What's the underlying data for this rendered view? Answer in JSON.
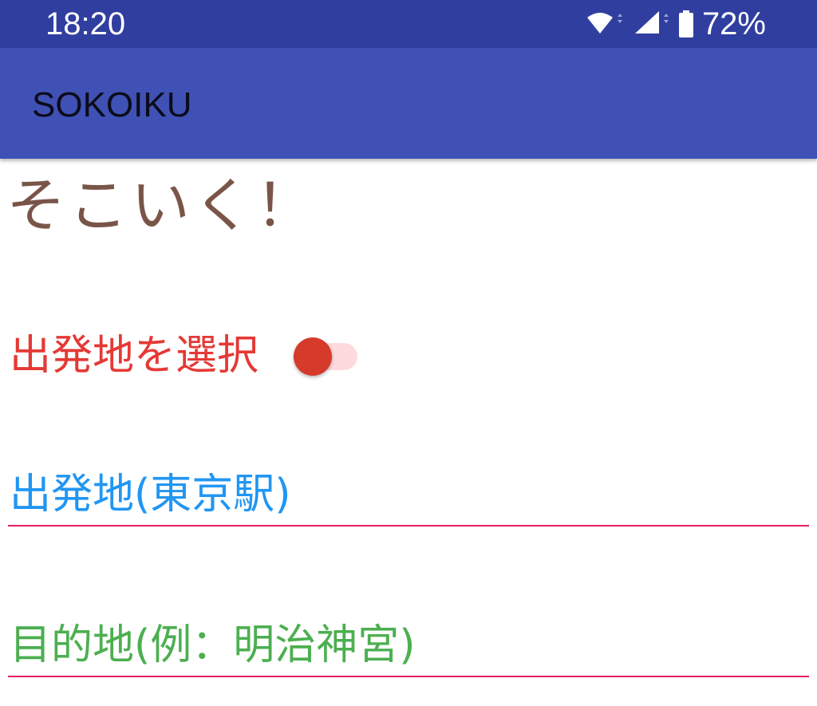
{
  "status_bar": {
    "time": "18:20",
    "battery": "72%",
    "icons": [
      "wifi-icon",
      "cell-signal-icon",
      "battery-icon"
    ],
    "background": "#303F9F"
  },
  "app_bar": {
    "title": "SOKOIKU",
    "background": "#3F51B5"
  },
  "main": {
    "heading": "そこいく！",
    "heading_color": "#795548",
    "origin_switch": {
      "label": "出発地を選択",
      "checked": true,
      "label_color": "#E53935",
      "thumb_color": "#D63A2A"
    },
    "origin_input": {
      "value": "",
      "placeholder": "出発地(東京駅)",
      "hint_color": "#2196F3"
    },
    "destination_input": {
      "value": "",
      "placeholder": "目的地(例：明治神宮)",
      "hint_color": "#4CAF50"
    },
    "underline_color": "#E91E63"
  }
}
